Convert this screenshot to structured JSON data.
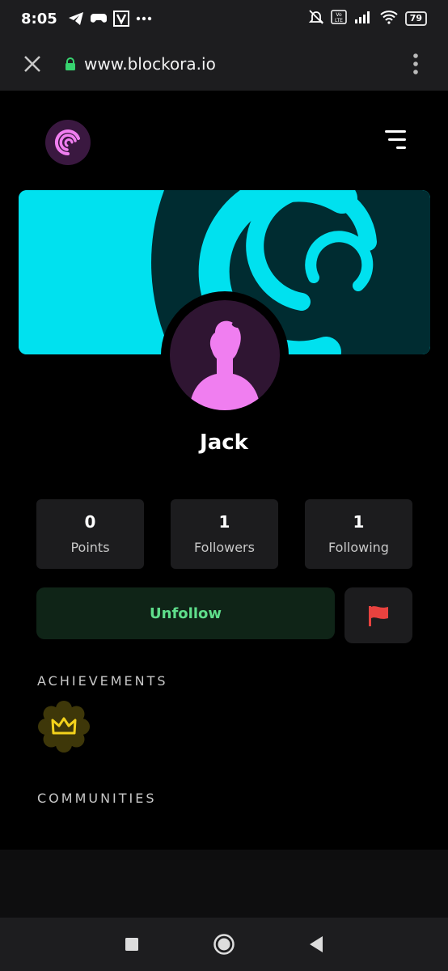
{
  "status_bar": {
    "time": "8:05",
    "battery": "79"
  },
  "browser": {
    "url": "www.blockora.io"
  },
  "profile": {
    "username": "Jack",
    "stats": [
      {
        "value": "0",
        "label": "Points"
      },
      {
        "value": "1",
        "label": "Followers"
      },
      {
        "value": "1",
        "label": "Following"
      }
    ],
    "unfollow_label": "Unfollow"
  },
  "sections": {
    "achievements": "ACHIEVEMENTS",
    "communities": "COMMUNITIES"
  },
  "colors": {
    "accent_cyan": "#00e1ef",
    "avatar_pink": "#f07ef0",
    "unfollow_green": "#5fde8b",
    "flag_red": "#e8423f",
    "badge_gold": "#f3d21c"
  }
}
